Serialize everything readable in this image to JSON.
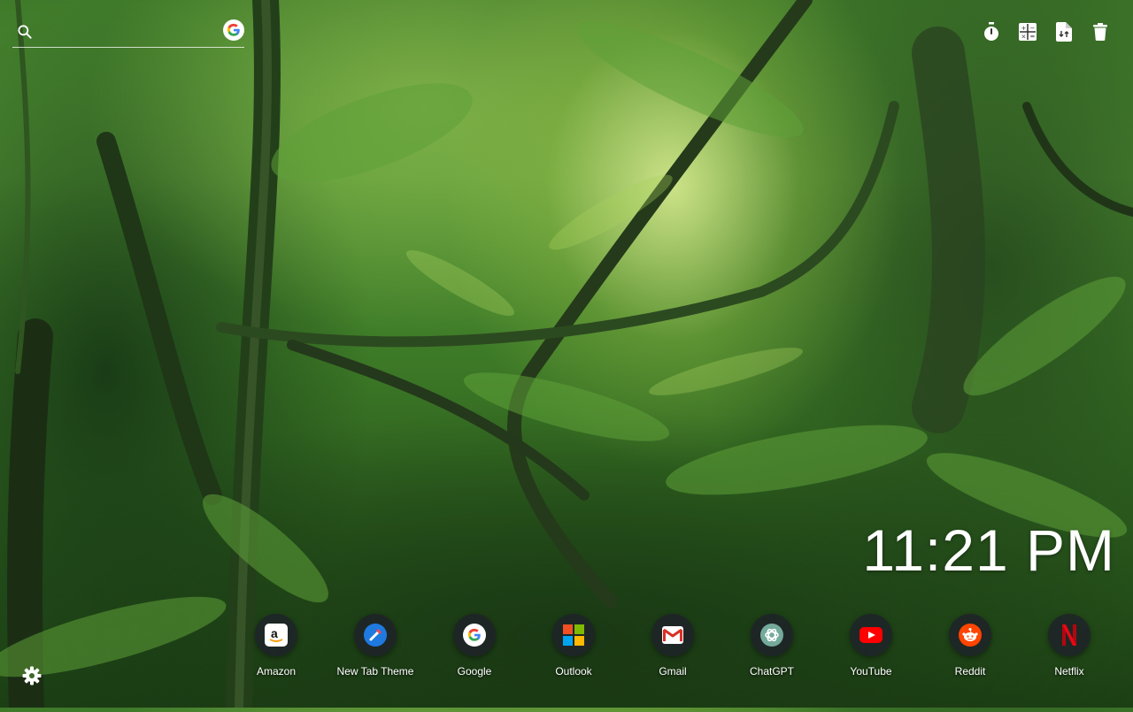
{
  "search": {
    "placeholder": "",
    "engine_icon": "google-icon"
  },
  "toolbar": {
    "icons": [
      "timer-icon",
      "calculator-icon",
      "file-convert-icon",
      "trash-icon"
    ]
  },
  "clock": {
    "time": "11:21 PM"
  },
  "shortcuts": [
    {
      "label": "Amazon",
      "icon": "amazon-icon"
    },
    {
      "label": "New Tab Theme",
      "icon": "new-tab-theme-icon"
    },
    {
      "label": "Google",
      "icon": "google-icon"
    },
    {
      "label": "Outlook",
      "icon": "outlook-icon"
    },
    {
      "label": "Gmail",
      "icon": "gmail-icon"
    },
    {
      "label": "ChatGPT",
      "icon": "chatgpt-icon"
    },
    {
      "label": "YouTube",
      "icon": "youtube-icon"
    },
    {
      "label": "Reddit",
      "icon": "reddit-icon"
    },
    {
      "label": "Netflix",
      "icon": "netflix-icon"
    }
  ],
  "settings": {
    "icon": "gear-icon"
  }
}
